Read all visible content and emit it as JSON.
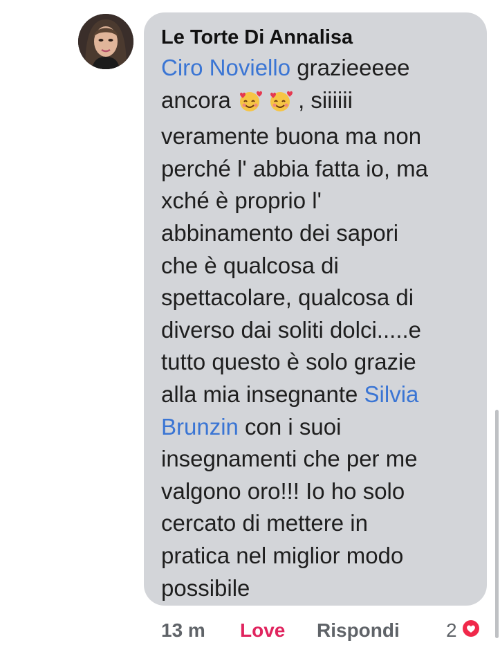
{
  "comment": {
    "author": "Le Torte Di Annalisa",
    "avatar_icon": "profile-avatar",
    "lines": [
      [
        "",
        "Ciro Noviello",
        " grazieeeee"
      ],
      [
        "ancora ",
        "",
        ", siiiiii"
      ],
      [
        "veramente buona ma non"
      ],
      [
        "perché l' abbia fatta io, ma"
      ],
      [
        "xché è proprio l'"
      ],
      [
        "abbinamento dei sapori"
      ],
      [
        "che è qualcosa di"
      ],
      [
        "spettacolare, qualcosa di"
      ],
      [
        "diverso dai soliti dolci.....e"
      ],
      [
        "tutto questo è solo grazie"
      ],
      [
        "alla mia insegnante ",
        "Silvia"
      ],
      [
        "Brunzin",
        " con i suoi"
      ],
      [
        "insegnamenti che per me"
      ],
      [
        "valgono oro!!! Io ho solo"
      ],
      [
        "cercato di mettere in"
      ],
      [
        "pratica nel miglior modo"
      ],
      [
        "possibile"
      ]
    ],
    "mention_1": "Ciro Noviello",
    "text_1": " grazieeeee",
    "text_2a": "ancora ",
    "text_2b": ", siiiiii",
    "emoji": "smiling-face-with-hearts",
    "text_mid": [
      "veramente buona ma non",
      "perché l' abbia fatta io, ma",
      "xché è proprio l'",
      "abbinamento dei sapori",
      "che è qualcosa di",
      "spettacolare, qualcosa di",
      "diverso dai soliti dolci.....e",
      "tutto questo è solo grazie"
    ],
    "text_11": "alla mia insegnante ",
    "mention_2a": "Silvia",
    "mention_2b": "Brunzin",
    "text_12": " con i suoi",
    "text_end": [
      "insegnamenti che per me",
      "valgono oro!!! Io ho solo",
      "cercato di mettere in",
      "pratica nel miglior modo",
      "possibile"
    ]
  },
  "actions": {
    "time": "13 m",
    "love": "Love",
    "reply": "Rispondi",
    "reaction_count": "2",
    "reaction_icon": "heart-reaction"
  },
  "colors": {
    "bubble": "#d3d5d9",
    "mention": "#3a75d4",
    "love": "#e0245e"
  }
}
